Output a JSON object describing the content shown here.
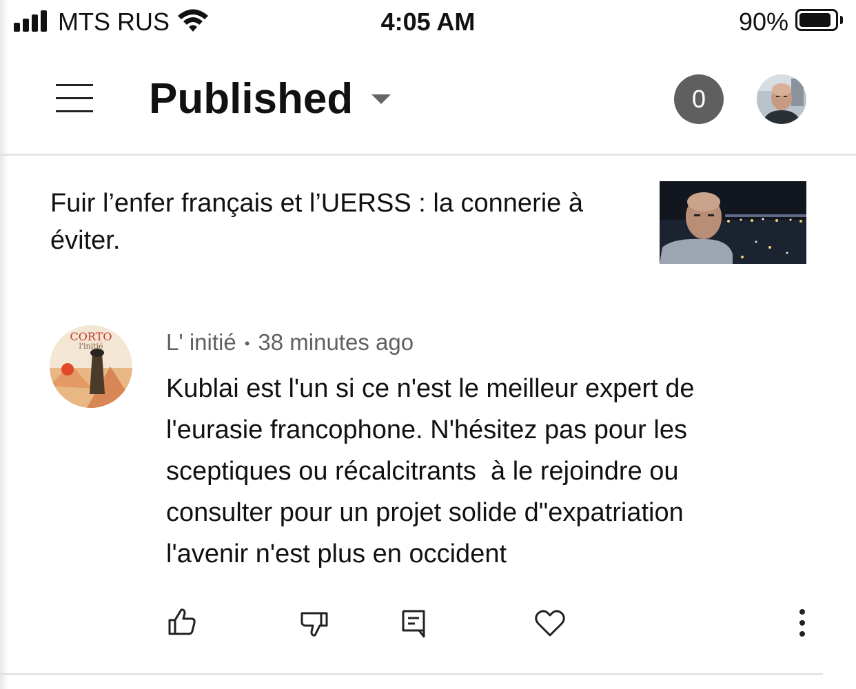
{
  "status_bar": {
    "carrier": "MTS RUS",
    "time": "4:05 AM",
    "battery_percent": "90%",
    "battery_level": 0.9,
    "signal_icon": "cellular-signal-icon",
    "wifi_icon": "wifi-icon",
    "battery_icon": "battery-icon"
  },
  "header": {
    "menu_icon": "hamburger-menu-icon",
    "title": "Published",
    "dropdown_icon": "caret-down-icon",
    "notification_count": "0",
    "avatar": "user-avatar"
  },
  "video": {
    "title": "Fuir l’enfer français et l’UERSS : la connerie à éviter.",
    "thumbnail": "video-thumbnail"
  },
  "comment": {
    "avatar": "commenter-avatar",
    "avatar_text_line1": "CORTO",
    "avatar_text_line2": "l'initié",
    "author": "L' initié",
    "separator": "•",
    "time_ago": "38 minutes ago",
    "text": "Kublai est l'un si ce n'est le meilleur expert de l'eurasie francophone. N'hésitez pas pour les sceptiques ou récalcitrants  à le rejoindre ou consulter pour un projet solide d\"expatriation l'avenir n'est plus en occident",
    "actions": [
      "thumbs-up-icon",
      "thumbs-down-icon",
      "reply-icon",
      "heart-icon",
      "more-vertical-icon"
    ]
  },
  "colors": {
    "text_primary": "#111111",
    "text_secondary": "#606060",
    "badge_bg": "#5f5f5f",
    "divider": "#e4e4e4"
  }
}
